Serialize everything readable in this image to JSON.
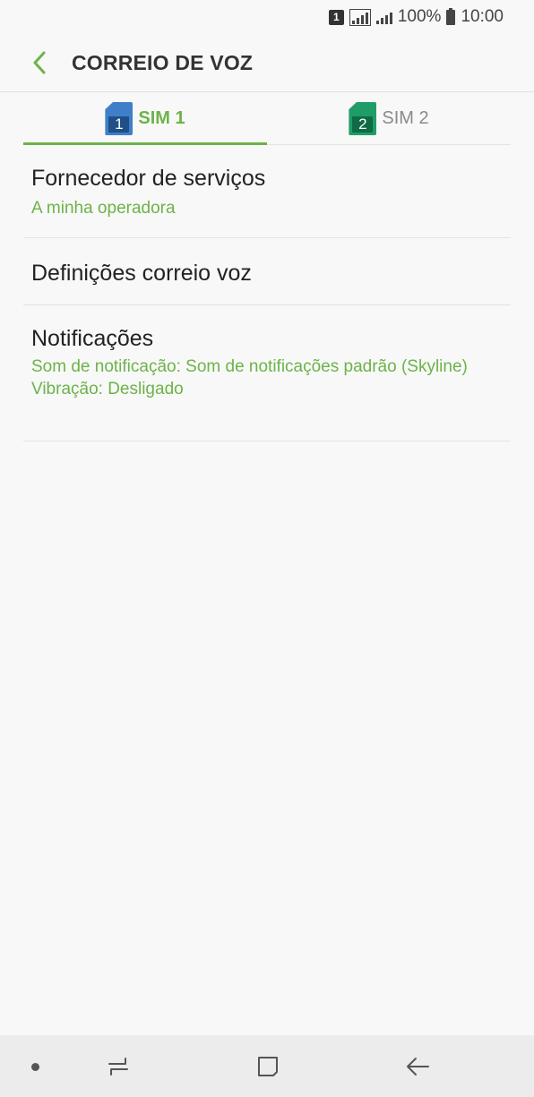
{
  "status_bar": {
    "sim_badge": "1",
    "battery_percent": "100%",
    "time": "10:00",
    "icons": [
      "sim-1-icon",
      "signal-sim1-icon",
      "signal-sim2-icon",
      "battery-icon"
    ]
  },
  "app_bar": {
    "back_icon": "chevron-left-icon",
    "title": "CORREIO DE VOZ"
  },
  "tabs": [
    {
      "label": "SIM 1",
      "sim_number": "1",
      "icon": "sim-card-icon",
      "icon_color": "#3f7fc9",
      "active": true
    },
    {
      "label": "SIM 2",
      "sim_number": "2",
      "icon": "sim-card-icon",
      "icon_color": "#1f9d66",
      "active": false
    }
  ],
  "list": [
    {
      "title": "Fornecedor de serviços",
      "subtitles": [
        "A minha operadora"
      ]
    },
    {
      "title": "Definições correio voz",
      "subtitles": []
    },
    {
      "title": "Notificações",
      "subtitles": [
        "Som de notificação: Som de notificações padrão (Skyline)",
        "Vibração: Desligado"
      ]
    }
  ],
  "nav_bar": {
    "icons": [
      "dot-indicator-icon",
      "recent-apps-icon",
      "home-icon",
      "back-arrow-icon"
    ]
  },
  "colors": {
    "accent": "#6cb349",
    "background": "#f8f8f8",
    "nav_background": "#ececec"
  }
}
